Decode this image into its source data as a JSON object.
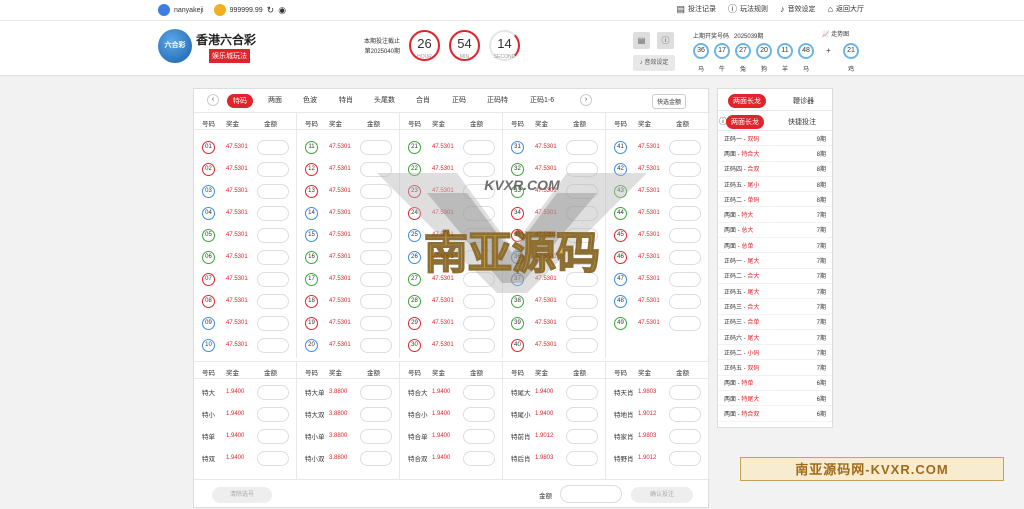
{
  "topbar": {
    "username": "nanyakeji",
    "balance": "999999.99",
    "links": [
      "投注记录",
      "玩法规则",
      "音效设定",
      "返回大厅"
    ]
  },
  "header": {
    "logo_text": "六合彩",
    "brand": "香港六合彩",
    "badge": "娱乐城玩法",
    "period_label": "本期投注截止",
    "period_no": "第2025040期",
    "countdown": [
      {
        "value": "26",
        "unit": "HOUR"
      },
      {
        "value": "54",
        "unit": "MIN"
      },
      {
        "value": "14",
        "unit": "SECOND"
      }
    ],
    "sound_label": "音效设定",
    "last_label": "上期开奖号码",
    "last_period": "2025039期",
    "trend_label": "走势图",
    "last_balls": [
      {
        "n": "36",
        "z": "马"
      },
      {
        "n": "17",
        "z": "牛"
      },
      {
        "n": "27",
        "z": "兔"
      },
      {
        "n": "20",
        "z": "狗"
      },
      {
        "n": "11",
        "z": "羊"
      },
      {
        "n": "48",
        "z": "马"
      },
      {
        "n": "21",
        "z": "鸡"
      }
    ]
  },
  "tabs": [
    "特码",
    "两面",
    "色波",
    "特肖",
    "头尾数",
    "合肖",
    "正码",
    "正码特",
    "正码1-6"
  ],
  "quick_bet": "快选金额",
  "col_headers": [
    "号码",
    "奖金",
    "金额"
  ],
  "odds_num": "47.5301",
  "numbers": [
    [
      "01",
      "02",
      "03",
      "04",
      "05",
      "06",
      "07",
      "08",
      "09",
      "10"
    ],
    [
      "11",
      "12",
      "13",
      "14",
      "15",
      "16",
      "17",
      "18",
      "19",
      "20"
    ],
    [
      "21",
      "22",
      "23",
      "24",
      "25",
      "26",
      "27",
      "28",
      "29",
      "30"
    ],
    [
      "31",
      "32",
      "33",
      "34",
      "35",
      "36",
      "37",
      "38",
      "39",
      "40"
    ],
    [
      "41",
      "42",
      "43",
      "44",
      "45",
      "46",
      "47",
      "48",
      "49"
    ]
  ],
  "ball_colors": {
    "01": "red",
    "02": "red",
    "03": "blue",
    "04": "blue",
    "05": "green",
    "06": "green",
    "07": "red",
    "08": "red",
    "09": "blue",
    "10": "blue",
    "11": "green",
    "12": "red",
    "13": "red",
    "14": "blue",
    "15": "blue",
    "16": "green",
    "17": "green",
    "18": "red",
    "19": "red",
    "20": "blue",
    "21": "green",
    "22": "green",
    "23": "red",
    "24": "red",
    "25": "blue",
    "26": "blue",
    "27": "green",
    "28": "green",
    "29": "red",
    "30": "red",
    "31": "blue",
    "32": "green",
    "33": "green",
    "34": "red",
    "35": "red",
    "36": "blue",
    "37": "blue",
    "38": "green",
    "39": "green",
    "40": "red",
    "41": "blue",
    "42": "blue",
    "43": "green",
    "44": "green",
    "45": "red",
    "46": "red",
    "47": "blue",
    "48": "blue",
    "49": "green"
  },
  "special": [
    [
      {
        "l": "特大",
        "o": "1.9400"
      },
      {
        "l": "特小",
        "o": "1.9400"
      },
      {
        "l": "特单",
        "o": "1.9400"
      },
      {
        "l": "特双",
        "o": "1.9400"
      }
    ],
    [
      {
        "l": "特大单",
        "o": "3.8800"
      },
      {
        "l": "特大双",
        "o": "3.8800"
      },
      {
        "l": "特小单",
        "o": "3.8800"
      },
      {
        "l": "特小双",
        "o": "3.8800"
      }
    ],
    [
      {
        "l": "特合大",
        "o": "1.9400"
      },
      {
        "l": "特合小",
        "o": "1.9400"
      },
      {
        "l": "特合单",
        "o": "1.9400"
      },
      {
        "l": "特合双",
        "o": "1.9400"
      }
    ],
    [
      {
        "l": "特尾大",
        "o": "1.9400"
      },
      {
        "l": "特尾小",
        "o": "1.9400"
      },
      {
        "l": "特前肖",
        "o": "1.9012"
      },
      {
        "l": "特后肖",
        "o": "1.9803"
      }
    ],
    [
      {
        "l": "特天肖",
        "o": "1.9803"
      },
      {
        "l": "特地肖",
        "o": "1.9012"
      },
      {
        "l": "特家肖",
        "o": "1.9803"
      },
      {
        "l": "特野肖",
        "o": "1.9012"
      }
    ]
  ],
  "footer": {
    "clear": "清除选号",
    "amount": "金额",
    "confirm": "确认投注"
  },
  "side": {
    "tab1": "两面长龙",
    "tab2": "鞭诊器",
    "sub1": "两面长龙",
    "sub2": "快捷投注",
    "rows": [
      {
        "a": "正码一 -",
        "b": "双码",
        "c": "9期"
      },
      {
        "a": "两面 -",
        "b": "特合大",
        "c": "8期"
      },
      {
        "a": "正码四 -",
        "b": "合双",
        "c": "8期"
      },
      {
        "a": "正码五 -",
        "b": "尾小",
        "c": "8期"
      },
      {
        "a": "正码二 -",
        "b": "单码",
        "c": "8期"
      },
      {
        "a": "两面 -",
        "b": "特大",
        "c": "7期"
      },
      {
        "a": "两面 -",
        "b": "总大",
        "c": "7期"
      },
      {
        "a": "两面 -",
        "b": "总单",
        "c": "7期"
      },
      {
        "a": "正码一 -",
        "b": "尾大",
        "c": "7期"
      },
      {
        "a": "正码二 -",
        "b": "合大",
        "c": "7期"
      },
      {
        "a": "正码五 -",
        "b": "尾大",
        "c": "7期"
      },
      {
        "a": "正码三 -",
        "b": "合大",
        "c": "7期"
      },
      {
        "a": "正码三 -",
        "b": "合单",
        "c": "7期"
      },
      {
        "a": "正码六 -",
        "b": "尾大",
        "c": "7期"
      },
      {
        "a": "正码二 -",
        "b": "小码",
        "c": "7期"
      },
      {
        "a": "正码五 -",
        "b": "双码",
        "c": "7期"
      },
      {
        "a": "两面 -",
        "b": "特单",
        "c": "6期"
      },
      {
        "a": "两面 -",
        "b": "特尾大",
        "c": "6期"
      },
      {
        "a": "两面 -",
        "b": "特合双",
        "c": "6期"
      }
    ]
  },
  "watermark": {
    "big": "南亚源码",
    "small": "KVXR.COM",
    "bottom": "南亚源码网-KVXR.COM"
  }
}
